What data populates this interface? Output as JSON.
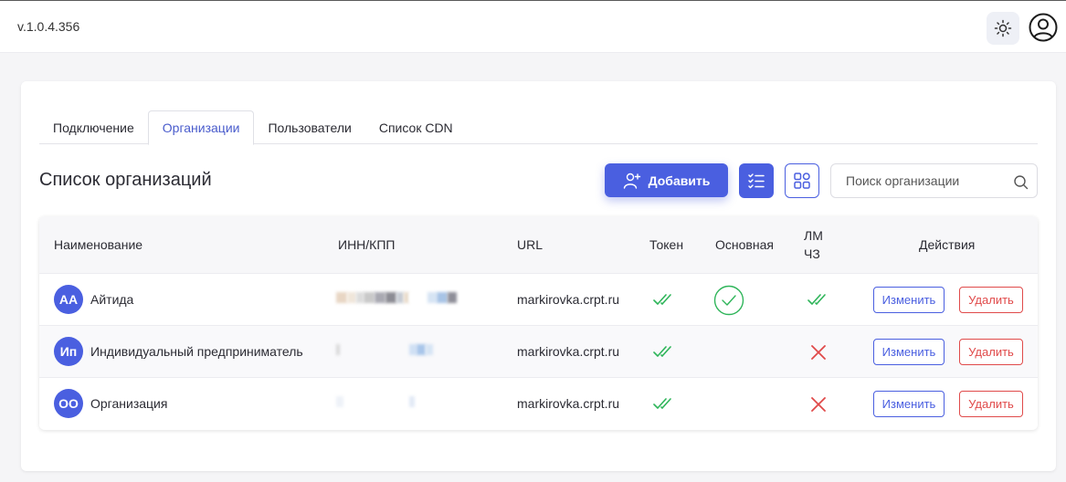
{
  "app": {
    "version": "v.1.0.4.356",
    "accent_color": "#4a5fe0",
    "success_color": "#2fb55a",
    "danger_color": "#e04a4a"
  },
  "header": {
    "theme_icon": "sun-icon",
    "user_icon": "user-circle-icon"
  },
  "tabs": [
    {
      "label": "Подключение",
      "active": false
    },
    {
      "label": "Организации",
      "active": true
    },
    {
      "label": "Пользователи",
      "active": false
    },
    {
      "label": "Список CDN",
      "active": false
    }
  ],
  "page": {
    "title": "Список организаций",
    "add_label": "Добавить",
    "search_placeholder": "Поиск организации"
  },
  "table": {
    "columns": {
      "name": "Наименование",
      "inn": "ИНН/КПП",
      "url": "URL",
      "token": "Токен",
      "main": "Основная",
      "lm_line1": "ЛМ",
      "lm_line2": "ЧЗ",
      "actions": "Действия"
    },
    "edit_label": "Изменить",
    "delete_label": "Удалить",
    "rows": [
      {
        "initials": "АА",
        "name": "Айтида",
        "url": "markirovka.crpt.ru",
        "token": true,
        "main": true,
        "lm": true
      },
      {
        "initials": "Ип",
        "name": "Индивидуальный предприниматель",
        "url": "markirovka.crpt.ru",
        "token": true,
        "main": false,
        "lm": false
      },
      {
        "initials": "ОО",
        "name": "Организация",
        "url": "markirovka.crpt.ru",
        "token": true,
        "main": false,
        "lm": false
      }
    ]
  }
}
